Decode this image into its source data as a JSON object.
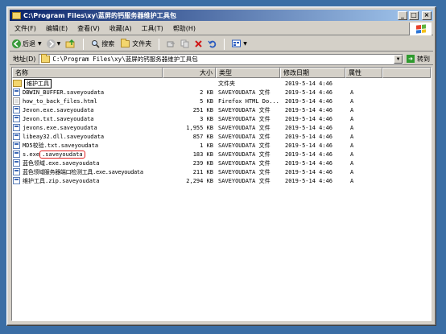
{
  "window": {
    "title": "C:\\Program Files\\xy\\蓝屏的钙服务器维护工具包",
    "minimize": "_",
    "maximize": "□",
    "close": "×"
  },
  "menu": [
    "文件(F)",
    "编辑(E)",
    "查看(V)",
    "收藏(A)",
    "工具(T)",
    "帮助(H)"
  ],
  "toolbar": {
    "back": "后退",
    "search": "搜索",
    "folders": "文件夹"
  },
  "address": {
    "label": "地址(D)",
    "value": "C:\\Program Files\\xy\\蓝屏的钙服务器维护工具包",
    "go": "转到"
  },
  "columns": {
    "name": "名称",
    "size": "大小",
    "type": "类型",
    "date": "修改日期",
    "attr": "属性"
  },
  "files": [
    {
      "name": "维护工具",
      "size": "",
      "type": "文件夹",
      "date": "2019-5-14 4:46",
      "attr": "",
      "kind": "folder"
    },
    {
      "name": "DBWIN_BUFFER.saveyoudata",
      "size": "2 KB",
      "type": "SAVEYOUDATA 文件",
      "date": "2019-5-14 4:46",
      "attr": "A",
      "kind": "file"
    },
    {
      "name": "how_to_back_files.html",
      "size": "5 KB",
      "type": "Firefox HTML Do...",
      "date": "2019-5-14 4:46",
      "attr": "A",
      "kind": "html"
    },
    {
      "name": "Jevon.exe.saveyoudata",
      "size": "251 KB",
      "type": "SAVEYOUDATA 文件",
      "date": "2019-5-14 4:46",
      "attr": "A",
      "kind": "file"
    },
    {
      "name": "Jevon.txt.saveyoudata",
      "size": "3 KB",
      "type": "SAVEYOUDATA 文件",
      "date": "2019-5-14 4:46",
      "attr": "A",
      "kind": "file"
    },
    {
      "name": "jevons.exe.saveyoudata",
      "size": "1,955 KB",
      "type": "SAVEYOUDATA 文件",
      "date": "2019-5-14 4:46",
      "attr": "A",
      "kind": "file"
    },
    {
      "name": "libeay32.dll.saveyoudata",
      "size": "857 KB",
      "type": "SAVEYOUDATA 文件",
      "date": "2019-5-14 4:46",
      "attr": "A",
      "kind": "file"
    },
    {
      "name": "MD5校验.txt.saveyoudata",
      "size": "1 KB",
      "type": "SAVEYOUDATA 文件",
      "date": "2019-5-14 4:46",
      "attr": "A",
      "kind": "file"
    },
    {
      "name_prefix": "s.exe",
      "name_highlight": ".saveyoudata",
      "size": "183 KB",
      "type": "SAVEYOUDATA 文件",
      "date": "2019-5-14 4:46",
      "attr": "A",
      "kind": "file"
    },
    {
      "name": "蓝色领域.exe.saveyoudata",
      "size": "239 KB",
      "type": "SAVEYOUDATA 文件",
      "date": "2019-5-14 4:46",
      "attr": "A",
      "kind": "file"
    },
    {
      "name": "蓝色领域服务器端口检测工具.exe.saveyoudata",
      "size": "211 KB",
      "type": "SAVEYOUDATA 文件",
      "date": "2019-5-14 4:46",
      "attr": "A",
      "kind": "file"
    },
    {
      "name": "维护工具.zip.saveyoudata",
      "size": "2,294 KB",
      "type": "SAVEYOUDATA 文件",
      "date": "2019-5-14 4:46",
      "attr": "A",
      "kind": "file"
    }
  ],
  "colors": {
    "desktop": "#3b6ea5",
    "titlebar_start": "#0a246a",
    "titlebar_end": "#a6caf0",
    "highlight_box": "#e02020"
  }
}
